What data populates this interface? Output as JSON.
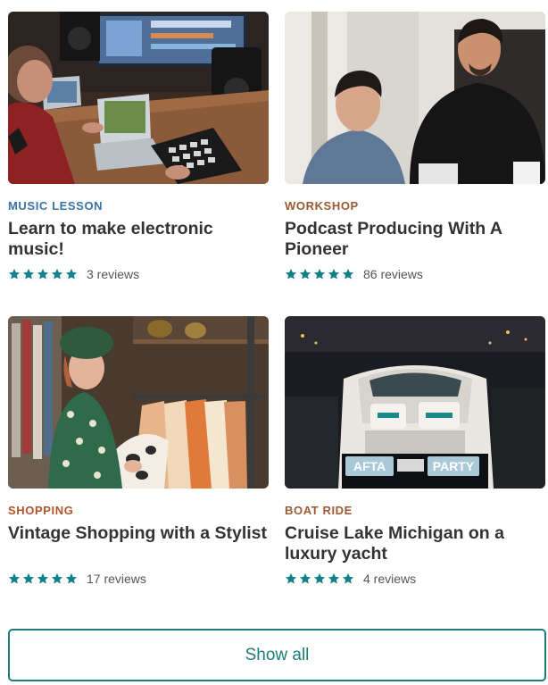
{
  "colors": {
    "star": "#12808c",
    "button": "#1c7d7b",
    "title": "#333333"
  },
  "cards": [
    {
      "category": "MUSIC LESSON",
      "category_color": "#3a74a8",
      "title": "Learn to make electronic music!",
      "image": "music-studio-photo",
      "rating_stars": 5,
      "reviews": "3 reviews"
    },
    {
      "category": "WORKSHOP",
      "category_color": "#9a5a33",
      "title": "Podcast Producing With A Pioneer",
      "image": "podcast-workshop-photo",
      "rating_stars": 5,
      "reviews": "86 reviews"
    },
    {
      "category": "SHOPPING",
      "category_color": "#b0552a",
      "title": "Vintage Shopping with a Stylist",
      "image": "vintage-clothing-photo",
      "rating_stars": 5,
      "reviews": "17 reviews"
    },
    {
      "category": "BOAT RIDE",
      "category_color": "#9a5a33",
      "title": "Cruise Lake Michigan on a luxury yacht",
      "image": "yacht-photo",
      "rating_stars": 5,
      "reviews": "4 reviews",
      "image_text": [
        "AFTA",
        "PARTY"
      ]
    }
  ],
  "show_all_label": "Show all"
}
